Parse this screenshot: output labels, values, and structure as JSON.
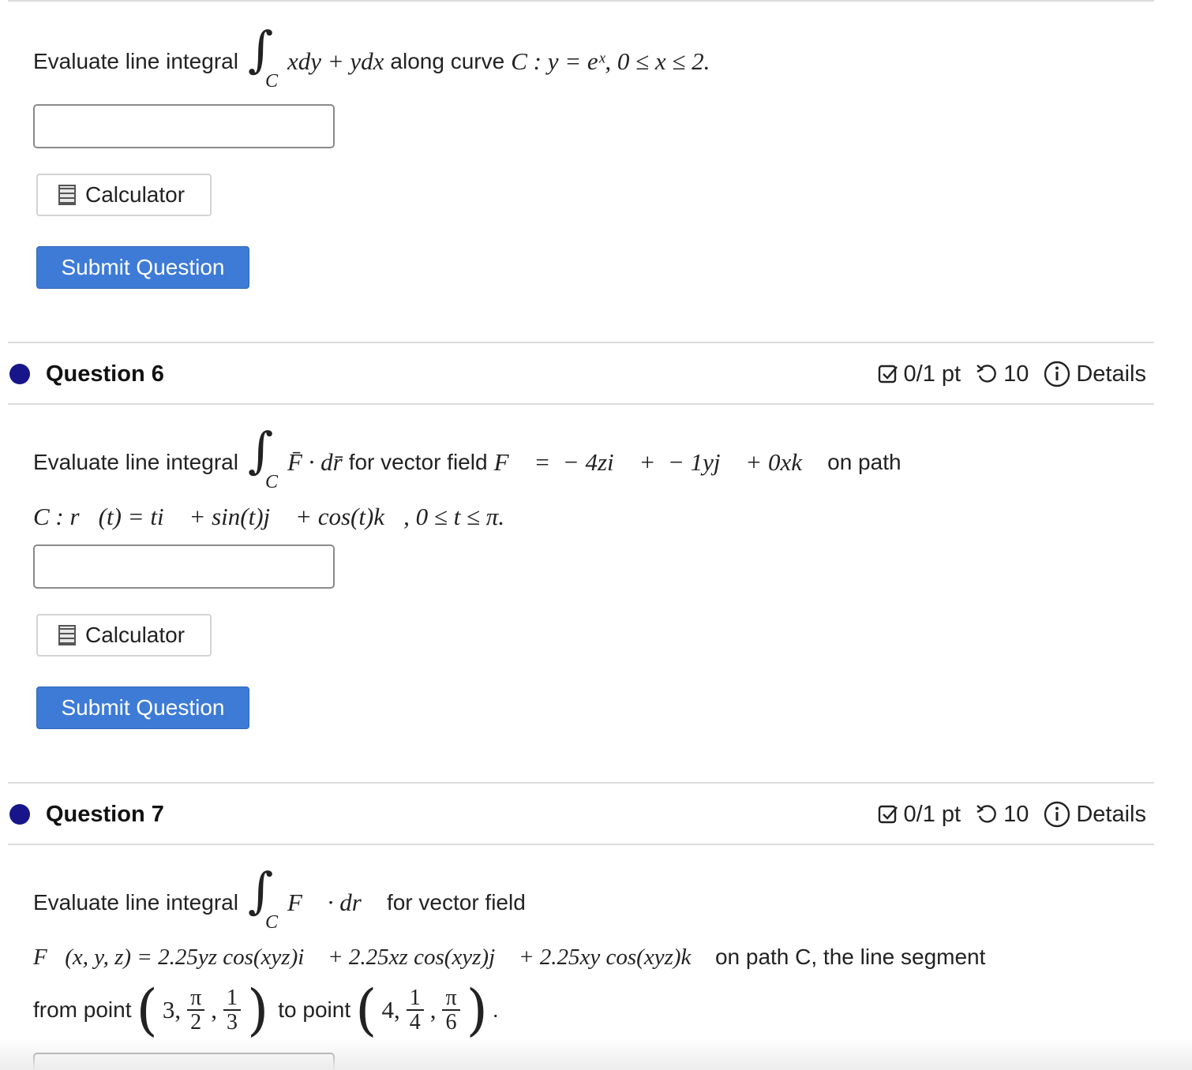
{
  "q5": {
    "prompt_lead": "Evaluate line integral",
    "integral_sub": "C",
    "integrand": "xdy + ydx",
    "prompt_mid": "along curve",
    "curve": "C : y = eˣ, 0 ≤ x ≤ 2.",
    "calculator_label": "Calculator",
    "submit_label": "Submit Question"
  },
  "q6": {
    "title": "Question 6",
    "score": "0/1 pt",
    "attempts": "10",
    "details_label": "Details",
    "prompt_lead": "Evaluate line integral",
    "integral_sub": "C",
    "integrand": "F̄ · dr̄",
    "prompt_mid": "for vector field",
    "field": "F⃗ =  − 4zi⃗ +  − 1yj⃗ + 0xk⃗",
    "prompt_end": "on path",
    "path": "C : r⃗(t) = ti⃗ + sin(t)j⃗ + cos(t)k⃗, 0 ≤ t ≤ π.",
    "calculator_label": "Calculator",
    "submit_label": "Submit Question"
  },
  "q7": {
    "title": "Question 7",
    "score": "0/1 pt",
    "attempts": "10",
    "details_label": "Details",
    "prompt_lead": "Evaluate line integral",
    "integral_sub": "C",
    "integrand": "F⃗ · dr⃗",
    "prompt_mid": "for vector field",
    "field": "F⃗(x, y, z) = 2.25yz cos(xyz)i⃗ + 2.25xz cos(xyz)j⃗ + 2.25xy cos(xyz)k⃗",
    "field_end": "on path C, the line segment",
    "from_label": "from point",
    "from_first": "3,",
    "from_f1_num": "π",
    "from_f1_den": "2",
    "from_f2_num": "1",
    "from_f2_den": "3",
    "to_label": "to point",
    "to_first": "4,",
    "to_f1_num": "1",
    "to_f1_den": "4",
    "to_f2_num": "π",
    "to_f2_den": "6",
    "end_period": "."
  },
  "colors": {
    "submit_bg": "#3e7bd6",
    "dot": "#16168a",
    "divider": "#dcdcdc"
  }
}
